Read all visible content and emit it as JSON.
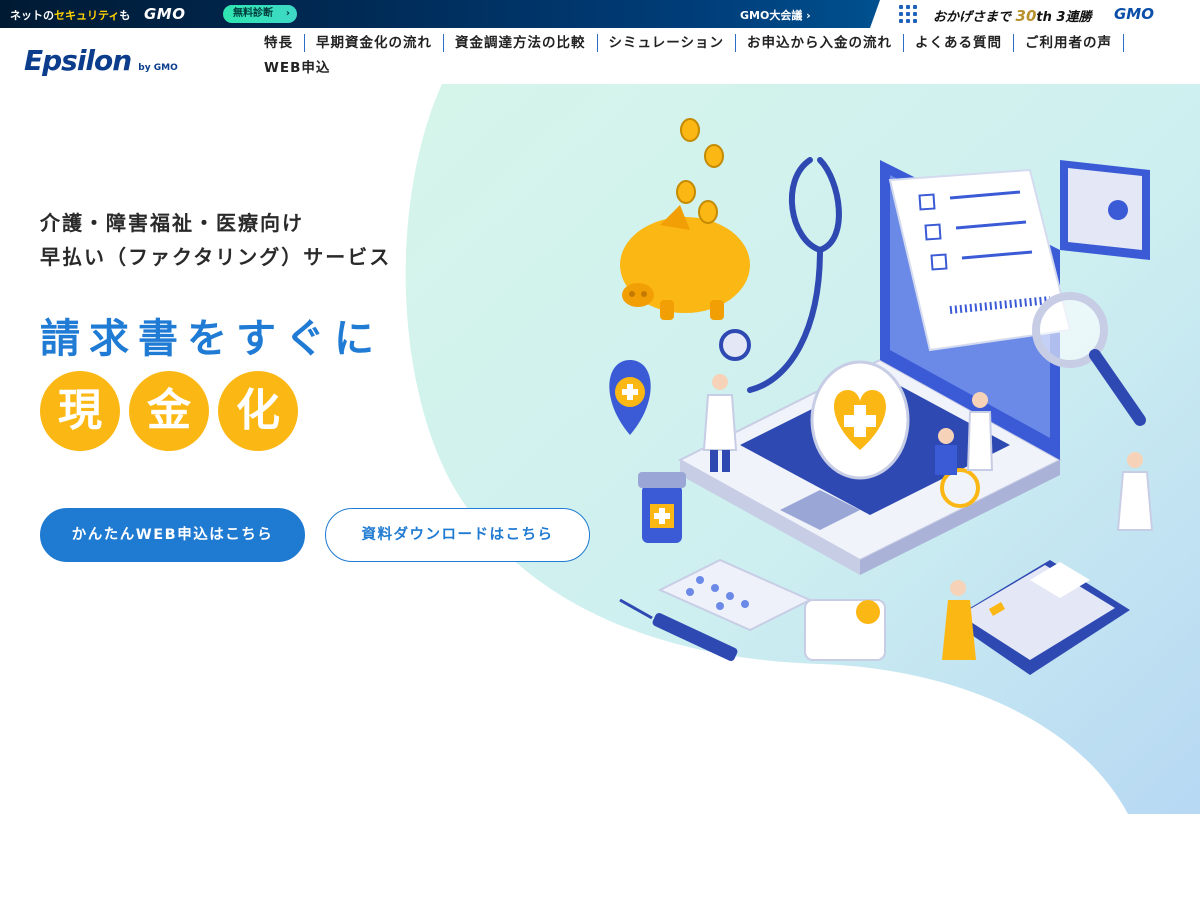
{
  "gmo_bar": {
    "net_prefix": "ネットの",
    "net_highlight": "セキュリティ",
    "net_suffix": "も",
    "gmo_logo": "GMO",
    "diagnosis_label": "無料診断",
    "diagnosis_chevron": "›",
    "conference_label": "GMO大会議 ›",
    "okage_prefix": "おかげさまで",
    "okage_number": "30",
    "okage_suffix": "th 3連勝",
    "gmo_logo_right": "GMO",
    "icons": [
      "grid-menu-icon"
    ]
  },
  "header": {
    "logo_text": "Epsilon",
    "logo_sub": "by GMO"
  },
  "nav": {
    "items": [
      {
        "label": "特長"
      },
      {
        "label": "早期資金化の流れ"
      },
      {
        "label": "資金調達方法の比較"
      },
      {
        "label": "シミュレーション"
      },
      {
        "label": "お申込から入金の流れ"
      },
      {
        "label": "よくある質問"
      },
      {
        "label": "ご利用者の声"
      },
      {
        "label": "WEB申込"
      }
    ]
  },
  "hero": {
    "lead_line1": "介護・障害福祉・医療向け",
    "lead_line2": "早払い（ファクタリング）サービス",
    "catch": "請求書をすぐに",
    "circle_chars": [
      "現",
      "金",
      "化"
    ],
    "primary_button": "かんたんWEB申込はこちら",
    "secondary_button": "資料ダウンロードはこちら",
    "illustration": "medical-finance-isometric-illustration"
  },
  "colors": {
    "brand_blue": "#1f7ad1",
    "logo_navy": "#0b3d8c",
    "accent_yellow": "#fbb714",
    "hero_mint": "#d2f3e9",
    "hero_sky": "#b9dcf2",
    "topbar_navy": "#002a55",
    "diag_green": "#2ee6b0"
  }
}
